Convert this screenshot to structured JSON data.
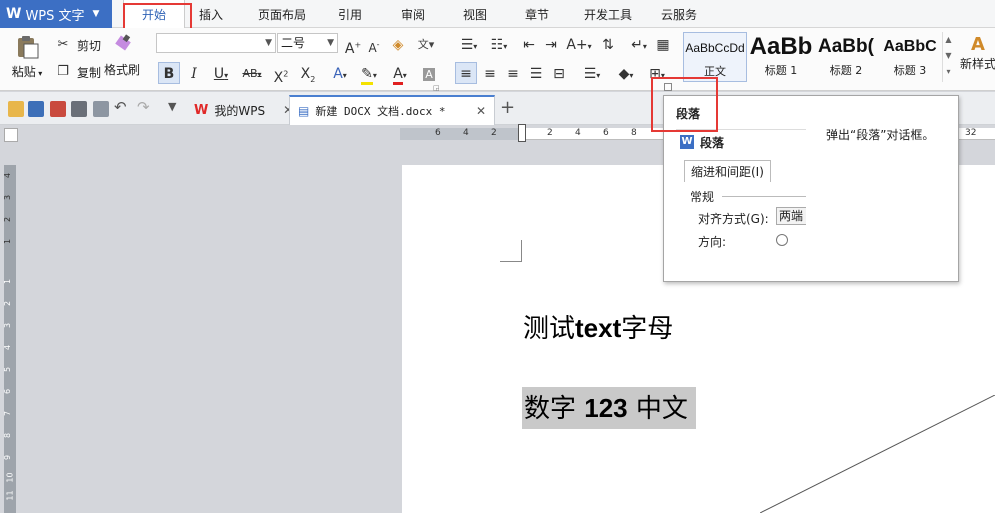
{
  "app": {
    "logo_text": "WPS 文字",
    "accent": "#3c6fc4"
  },
  "menu": {
    "tabs": [
      "开始",
      "插入",
      "页面布局",
      "引用",
      "审阅",
      "视图",
      "章节",
      "开发工具",
      "云服务"
    ],
    "active": "开始"
  },
  "ribbon": {
    "paste_label": "粘贴",
    "cut_label": "剪切",
    "copy_label": "复制",
    "format_painter_label": "格式刷",
    "font_name_value": "",
    "font_size_value": "二号",
    "styles": [
      {
        "sample": "AaBbCcDd",
        "name": "正文"
      },
      {
        "sample": "AaBb",
        "name": "标题 1"
      },
      {
        "sample": "AaBb(",
        "name": "标题 2"
      },
      {
        "sample": "AaBbC",
        "name": "标题 3"
      }
    ],
    "new_style_label": "新样式"
  },
  "tabs": {
    "home_tab": "我的WPS",
    "doc_tab": "新建 DOCX 文档.docx *"
  },
  "rulers": {
    "horizontal": [
      "6",
      "4",
      "2",
      "2",
      "4",
      "6",
      "8",
      "32"
    ],
    "vertical": [
      "4",
      "3",
      "2",
      "1",
      "1",
      "2",
      "3",
      "4",
      "5",
      "6",
      "7",
      "8",
      "9",
      "10",
      "11",
      "12"
    ]
  },
  "document": {
    "line1_a": "测试",
    "line1_b": "text",
    "line1_c": "字母",
    "line2_a": "数字 ",
    "line2_b": "123",
    "line2_c": " 中文"
  },
  "tooltip": {
    "title": "段落",
    "description": "弹出“段落”对话框。",
    "dialog_title": "段落",
    "dialog_tab": "缩进和间距(I)",
    "section": "常规",
    "align_label": "对齐方式(G):",
    "align_value": "两端",
    "direction_label": "方向:"
  },
  "highlight_color": "#e53935"
}
